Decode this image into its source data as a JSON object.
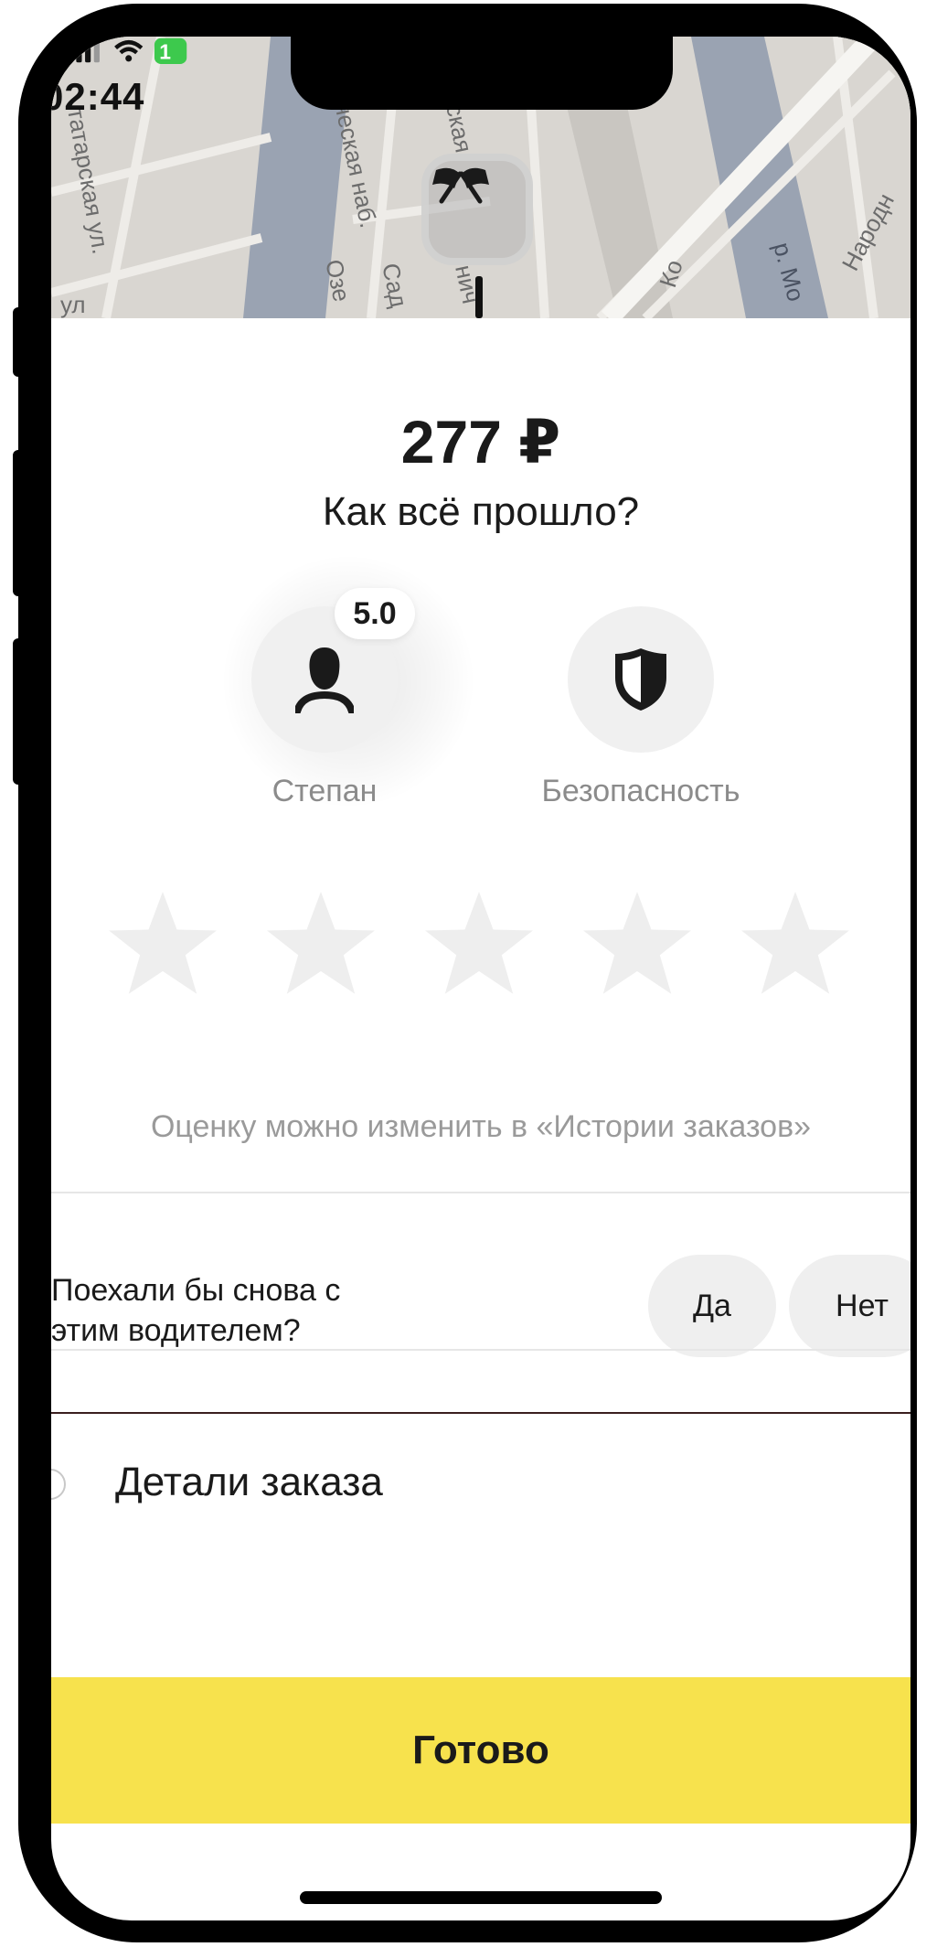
{
  "status_bar": {
    "time": "02:44",
    "battery_text": "1"
  },
  "map": {
    "street_labels": [
      "татарская ул.",
      "ческая наб.",
      "ская",
      "Озе",
      "Сад",
      "нич",
      "Ко",
      "р. Мо",
      "Народн",
      "ул"
    ]
  },
  "order": {
    "price": "277 ₽",
    "question": "Как всё прошло?"
  },
  "driver": {
    "name": "Степан",
    "rating": "5.0"
  },
  "safety": {
    "label": "Безопасность"
  },
  "stars": {
    "count": 5,
    "selected": 0
  },
  "hint": "Оценку можно изменить в «Истории заказов»",
  "ride_again": {
    "question_line1": "Поехали бы снова с",
    "question_line2": "этим водителем?",
    "yes_label": "Да",
    "no_label": "Нет"
  },
  "details": {
    "label": "Детали заказа"
  },
  "done_button": {
    "label": "Готово"
  },
  "colors": {
    "accent_yellow": "#f7e24d",
    "star_empty": "#eeeeee",
    "label_gray": "#8b8b8b"
  }
}
